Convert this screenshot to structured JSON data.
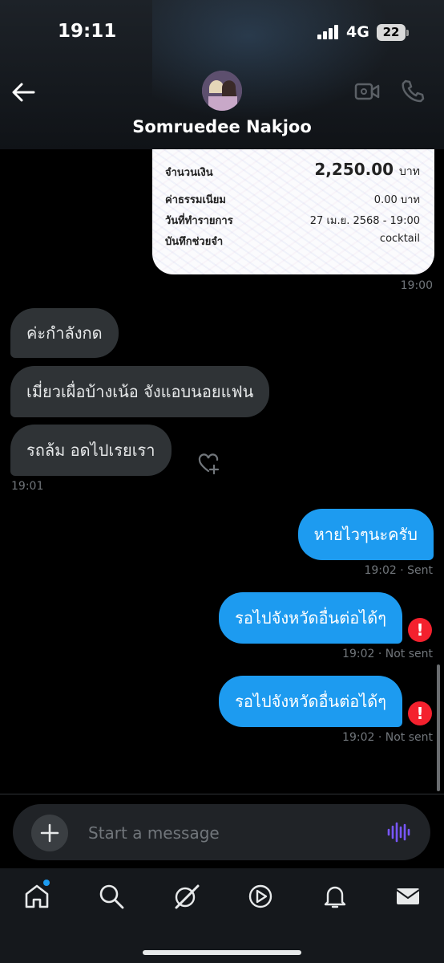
{
  "status_bar": {
    "time": "19:11",
    "network": "4G",
    "battery": "22"
  },
  "header": {
    "contact_name": "Somruedee Nakjoo"
  },
  "slip": {
    "amount_label": "จำนวนเงิน",
    "amount_value": "2,250.00",
    "amount_unit": "บาท",
    "fee_label": "ค่าธรรมเนียม",
    "fee_value": "0.00 บาท",
    "date_label": "วันที่ทำรายการ",
    "date_value": "27 เม.ย. 2568 - 19:00",
    "memo_label": "บันทึกช่วยจำ",
    "memo_value": "cocktail"
  },
  "messages": {
    "slip_time": "19:00",
    "incoming": [
      {
        "text": "ค่ะกำลังกด"
      },
      {
        "text": "เมี่ยวเผื่อบ้างเน้อ จังแอบนอยแฟน"
      },
      {
        "text": "รถล้ม  อดไปเรยเรา"
      }
    ],
    "incoming_time": "19:01",
    "outgoing": [
      {
        "text": "หายไวๆนะครับ",
        "meta": "19:02 · Sent"
      },
      {
        "text": "รอไปจังหวัดอื่นต่อได้ๆ",
        "meta": "19:02 · Not sent"
      },
      {
        "text": "รอไปจังหวัดอื่นต่อได้ๆ",
        "meta": "19:02 · Not sent"
      }
    ]
  },
  "composer": {
    "placeholder": "Start a message"
  },
  "colors": {
    "accent": "#1d9bf0",
    "error": "#f4212e",
    "incoming_bubble": "#2f3336",
    "voice": "#7856ff"
  },
  "icons": [
    "back-arrow-icon",
    "video-call-icon",
    "phone-icon",
    "heart-plus-icon",
    "error-icon",
    "plus-icon",
    "voice-wave-icon",
    "home-icon",
    "search-icon",
    "grok-icon",
    "video-icon",
    "bell-icon",
    "mail-icon"
  ]
}
